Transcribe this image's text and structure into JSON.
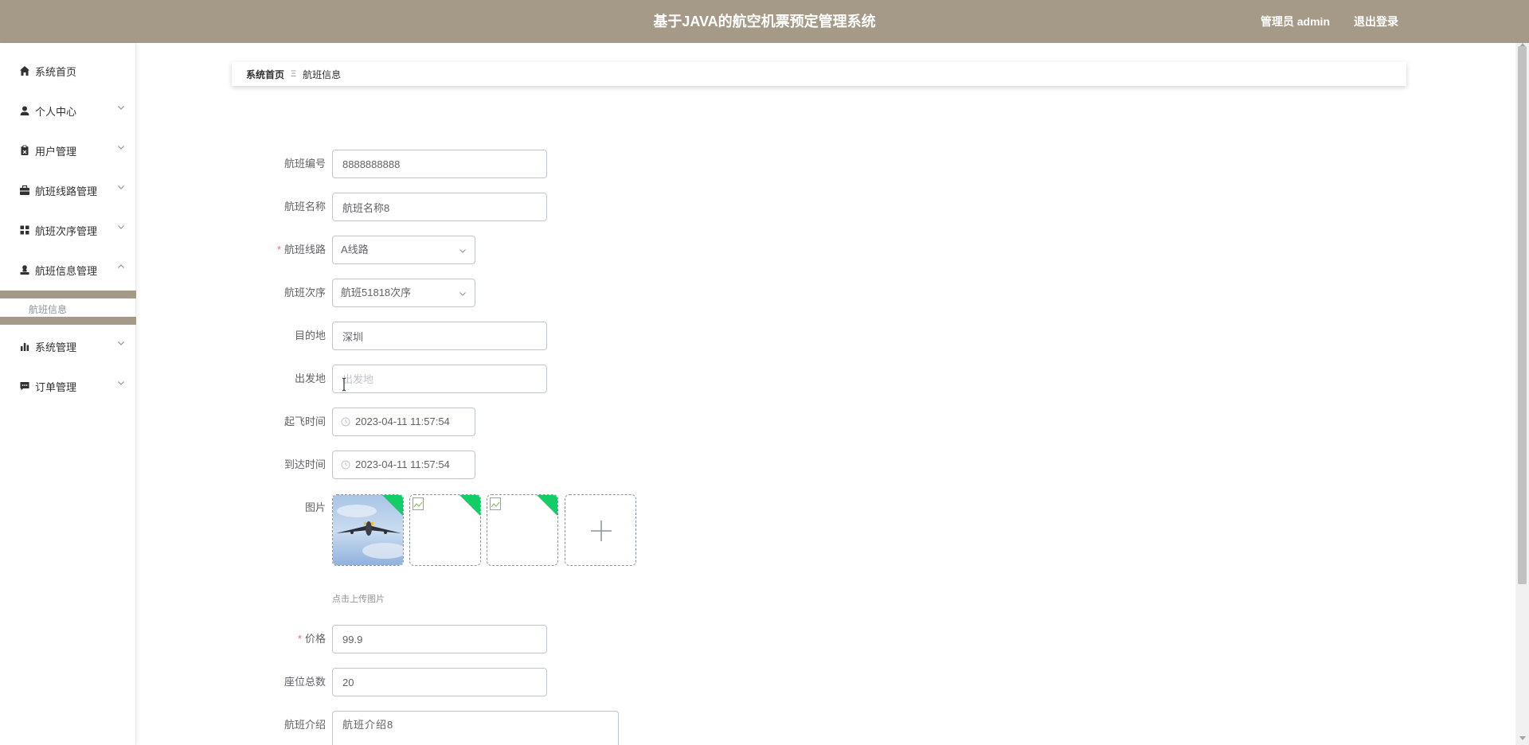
{
  "header": {
    "title": "基于JAVA的航空机票预定管理系统",
    "user_label": "管理员 admin",
    "logout_label": "退出登录"
  },
  "sidebar": {
    "items": [
      {
        "label": "系统首页",
        "icon": "home-icon"
      },
      {
        "label": "个人中心",
        "icon": "user-icon"
      },
      {
        "label": "用户管理",
        "icon": "clipboard-icon"
      },
      {
        "label": "航班线路管理",
        "icon": "briefcase-icon"
      },
      {
        "label": "航班次序管理",
        "icon": "grid-icon"
      },
      {
        "label": "航班信息管理",
        "icon": "person-stamp-icon"
      },
      {
        "label": "系统管理",
        "icon": "bar-chart-icon"
      },
      {
        "label": "订单管理",
        "icon": "chat-icon"
      }
    ],
    "active_sub": "航班信息"
  },
  "breadcrumb": {
    "home": "系统首页",
    "separator": "Ξ",
    "current": "航班信息"
  },
  "form": {
    "flight_no": {
      "label": "航班编号",
      "value": "8888888888"
    },
    "flight_name": {
      "label": "航班名称",
      "value": "航班名称8"
    },
    "route": {
      "label": "航班线路",
      "value": "A线路",
      "required": "*"
    },
    "sequence": {
      "label": "航班次序",
      "value": "航班51818次序"
    },
    "destination": {
      "label": "目的地",
      "value": "深圳"
    },
    "origin": {
      "label": "出发地",
      "placeholder": "出发地"
    },
    "depart_time": {
      "label": "起飞时间",
      "value": "2023-04-11 11:57:54"
    },
    "arrive_time": {
      "label": "到达时间",
      "value": "2023-04-11 11:57:54"
    },
    "image": {
      "label": "图片",
      "tip": "点击上传图片"
    },
    "price": {
      "label": "价格",
      "value": "99.9",
      "required": "*"
    },
    "seats": {
      "label": "座位总数",
      "value": "20"
    },
    "intro": {
      "label": "航班介绍",
      "value": "航班介绍8"
    }
  },
  "colors": {
    "theme": "#a49a87",
    "success_corner": "#13ce66",
    "required": "#f56c6c"
  }
}
